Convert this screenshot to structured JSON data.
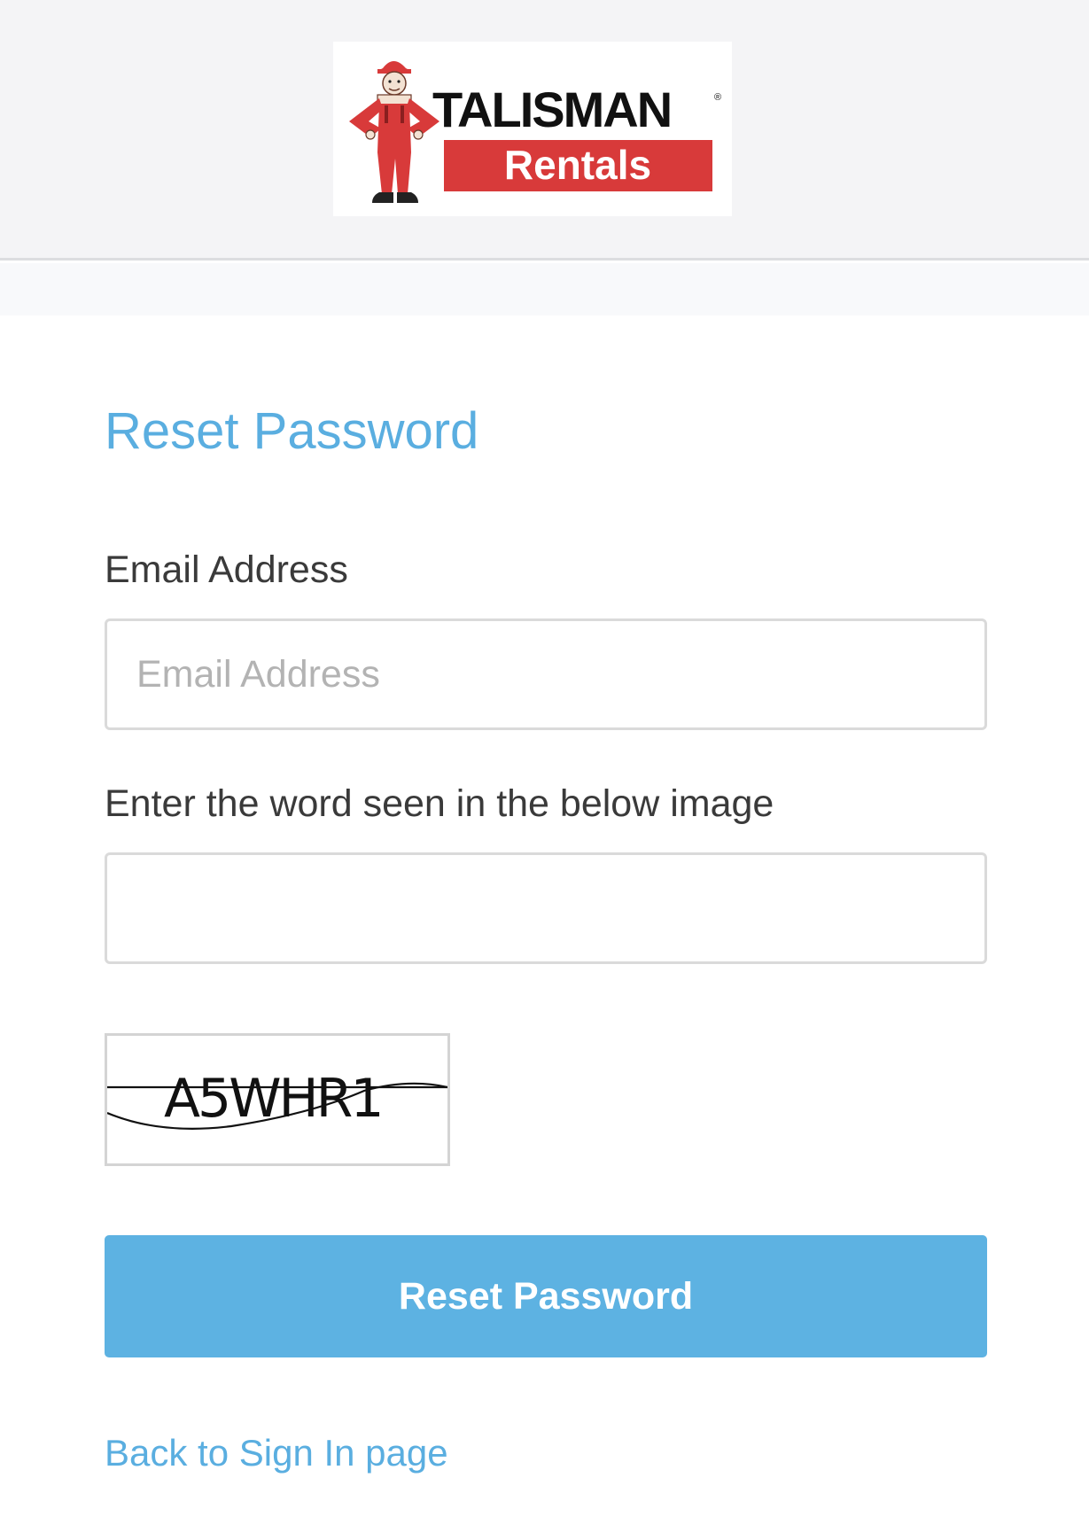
{
  "header": {
    "logo": {
      "line1": "TALISMAN",
      "line2": "Rentals",
      "mark": "®",
      "icon": "worker-mascot-icon",
      "brand_red": "#d83a3a",
      "brand_black": "#111111"
    }
  },
  "form": {
    "title": "Reset Password",
    "email": {
      "label": "Email Address",
      "placeholder": "Email Address",
      "value": ""
    },
    "captcha": {
      "label": "Enter the word seen in the below image",
      "value": "",
      "image_text": "A5WHR1"
    },
    "submit_label": "Reset Password",
    "back_link": "Back to Sign In page"
  },
  "colors": {
    "accent": "#5aaee0",
    "button": "#5db2e2",
    "header_bg": "#f4f4f6"
  }
}
